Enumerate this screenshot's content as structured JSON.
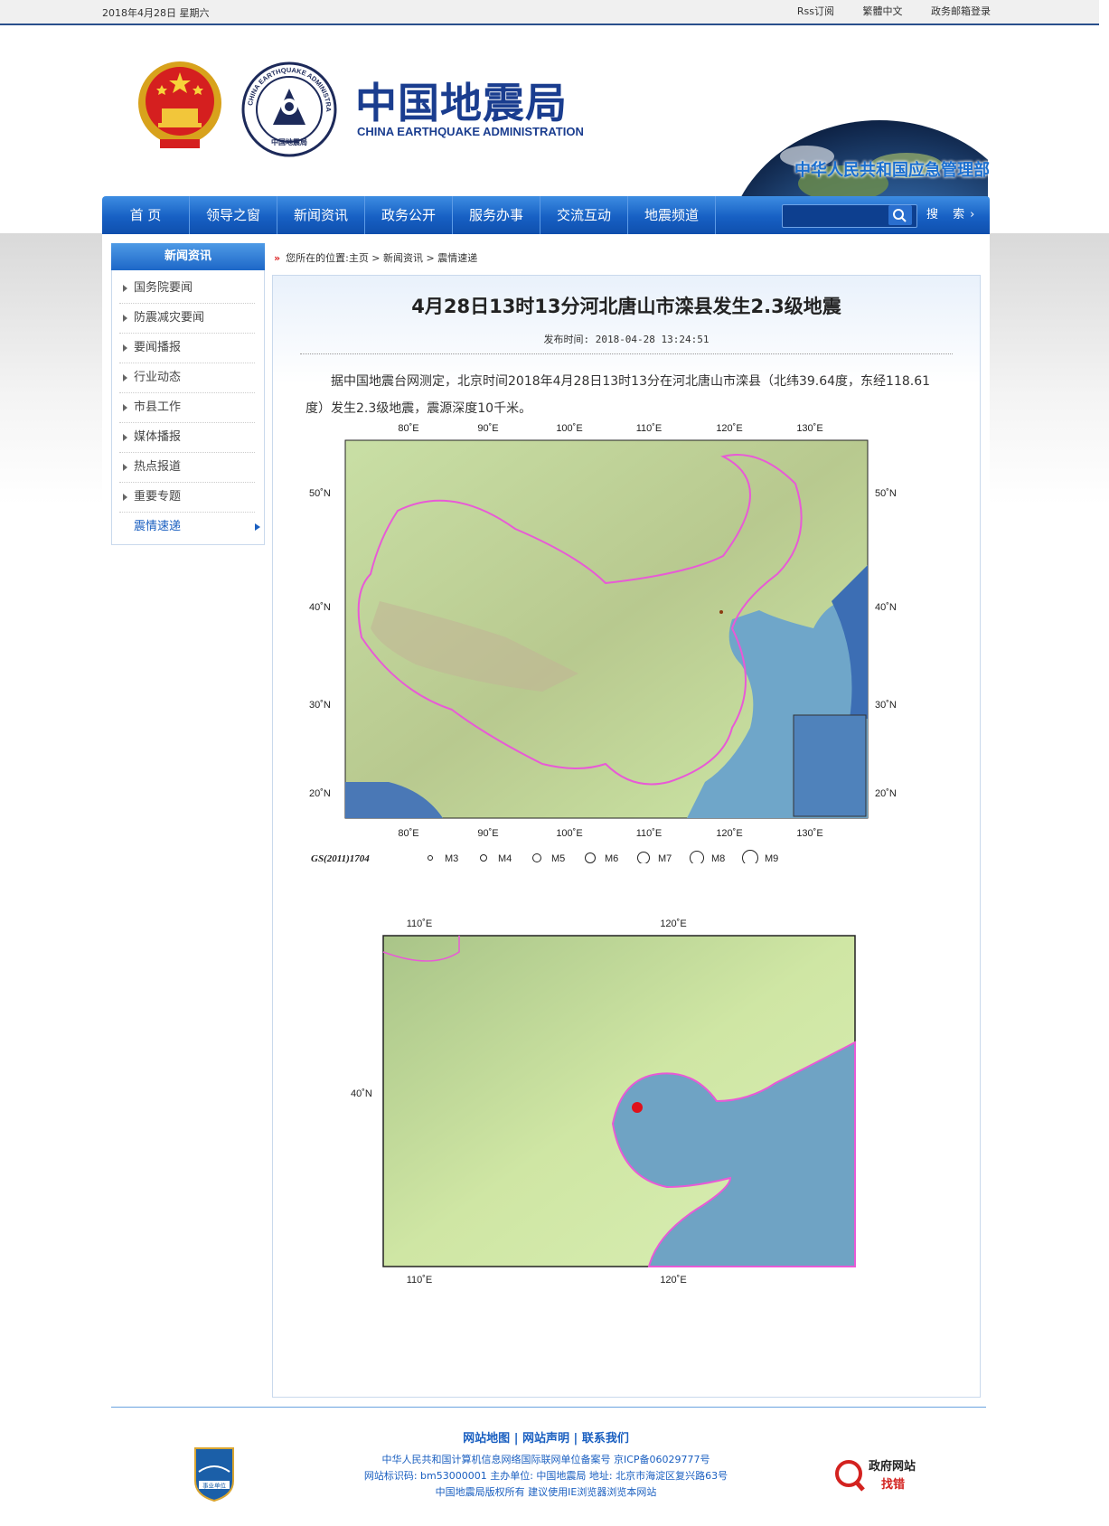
{
  "topbar": {
    "date": "2018年4月28日  星期六",
    "links": [
      "Rss订阅",
      "繁體中文",
      "政务邮箱登录"
    ]
  },
  "header": {
    "title_cn": "中国地震局",
    "title_en": "CHINA EARTHQUAKE ADMINISTRATION",
    "ministry": "中华人民共和国应急管理部",
    "seal_text": "CHINA EARTHQUAKE ADMINISTRATION",
    "seal_text_cn": "中国地震局"
  },
  "nav": {
    "items": [
      "首  页",
      "领导之窗",
      "新闻资讯",
      "政务公开",
      "服务办事",
      "交流互动",
      "地震频道"
    ],
    "search_label": "搜 索",
    "search_arrow": "›"
  },
  "sidebar": {
    "title": "新闻资讯",
    "items": [
      "国务院要闻",
      "防震减灾要闻",
      "要闻播报",
      "行业动态",
      "市县工作",
      "媒体播报",
      "热点报道",
      "重要专题",
      "震情速递"
    ],
    "active_index": 8
  },
  "breadcrumb": {
    "arrow": "»",
    "text": "您所在的位置:主页 > 新闻资讯 > 震情速递"
  },
  "article": {
    "title": "4月28日13时13分河北唐山市滦县发生2.3级地震",
    "time": "发布时间: 2018-04-28 13:24:51",
    "body": "据中国地震台网测定，北京时间2018年4月28日13时13分在河北唐山市滦县（北纬39.64度，东经118.61度）发生2.3级地震，震源深度10千米。"
  },
  "map1": {
    "lon_ticks": [
      "80˚E",
      "90˚E",
      "100˚E",
      "110˚E",
      "120˚E",
      "130˚E"
    ],
    "lat_ticks": [
      "50˚N",
      "40˚N",
      "30˚N",
      "20˚N"
    ],
    "gs_code": "GS(2011)1704",
    "magnitudes": [
      "M3",
      "M4",
      "M5",
      "M6",
      "M7",
      "M8",
      "M9"
    ]
  },
  "map2": {
    "lon_ticks": [
      "110˚E",
      "120˚E"
    ],
    "lat_ticks": [
      "40˚N"
    ]
  },
  "footer": {
    "links": [
      "网站地图",
      "网站声明",
      "联系我们"
    ],
    "line1": "中华人民共和国计算机信息网络国际联网单位备案号  京ICP备06029777号",
    "line2": "网站标识码: bm53000001  主办单位: 中国地震局  地址: 北京市海淀区复兴路63号",
    "line3": "中国地震局版权所有  建议使用IE浏览器浏览本网站",
    "badge_label": "事业单位",
    "gov_label1": "政府网站",
    "gov_label2": "找错"
  },
  "colors": {
    "brand_blue": "#1a5fc0",
    "nav_blue": "#1760c4",
    "coast_pink": "#e85ad6",
    "epicenter": "#e0111b"
  }
}
